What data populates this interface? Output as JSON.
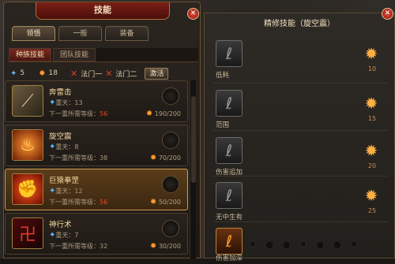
{
  "window": {
    "title": "技能"
  },
  "tabs": [
    "领悟",
    "一般",
    "装备"
  ],
  "subtabs": [
    "种族技能",
    "团队技能"
  ],
  "stats": {
    "blue_value": "5",
    "orange_value": "18",
    "path1": "法门一",
    "path2": "法门二",
    "activate": "激活"
  },
  "skills": [
    {
      "name": "奔雷击",
      "level": "重天：13",
      "req_label": "下一重所需等级：",
      "req_value": "56",
      "count": "190/200",
      "icon": "spear-icon"
    },
    {
      "name": "旋空震",
      "level": "重天：8",
      "req_label": "下一重所需等级：",
      "req_value": "38",
      "count": "70/200",
      "icon": "flame-icon"
    },
    {
      "name": "巨猿拳罡",
      "level": "重天：12",
      "req_label": "下一重所需等级：",
      "req_value": "56",
      "count": "50/200",
      "icon": "fist-icon"
    },
    {
      "name": "神行术",
      "level": "重天：7",
      "req_label": "下一重所需等级：",
      "req_value": "32",
      "count": "30/200",
      "icon": "rune-icon"
    }
  ],
  "refine": {
    "title": "精修技能（旋空震）",
    "items": [
      {
        "label": "低耗",
        "value": "10"
      },
      {
        "label": "范围",
        "value": "15"
      },
      {
        "label": "伤害追加",
        "value": "20"
      },
      {
        "label": "无中生有",
        "value": "25"
      },
      {
        "label": "伤害加深"
      }
    ]
  },
  "colors": {
    "accent": "#7a1f16",
    "gold": "#d0a050"
  }
}
